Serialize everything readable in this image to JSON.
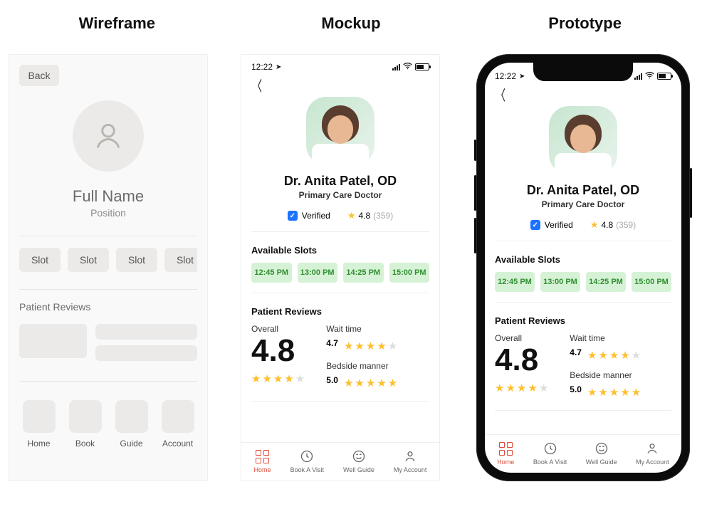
{
  "titles": {
    "wireframe": "Wireframe",
    "mockup": "Mockup",
    "prototype": "Prototype"
  },
  "statusbar": {
    "time": "12:22"
  },
  "wireframe": {
    "back_label": "Back",
    "name_ph": "Full Name",
    "position_ph": "Position",
    "slot_ph": "Slot",
    "reviews_label": "Patient Reviews",
    "tabs": [
      "Home",
      "Book",
      "Guide",
      "Account"
    ]
  },
  "doctor": {
    "name": "Dr. Anita Patel, OD",
    "role": "Primary Care Doctor",
    "verified_label": "Verified",
    "rating": "4.8",
    "rating_count": "(359)"
  },
  "slots": {
    "section_label": "Available Slots",
    "items": [
      "12:45 PM",
      "13:00 PM",
      "14:25 PM",
      "15:00 PM"
    ]
  },
  "reviews": {
    "section_label": "Patient Reviews",
    "overall_label": "Overall",
    "overall_value": "4.8",
    "wait_label": "Wait time",
    "wait_value": "4.7",
    "bedside_label": "Bedside manner",
    "bedside_value": "5.0"
  },
  "tabbar": {
    "items": [
      {
        "label": "Home",
        "icon": "grid-icon",
        "active": true
      },
      {
        "label": "Book A Visit",
        "icon": "clock-icon"
      },
      {
        "label": "Well Guide",
        "icon": "smile-icon"
      },
      {
        "label": "My Account",
        "icon": "person-icon"
      }
    ]
  },
  "colors": {
    "accent_red": "#e04a3b",
    "slot_bg": "#d6f2d6",
    "slot_text": "#2f8f2f",
    "star": "#fdbf2d",
    "verify_blue": "#1d72ff"
  }
}
